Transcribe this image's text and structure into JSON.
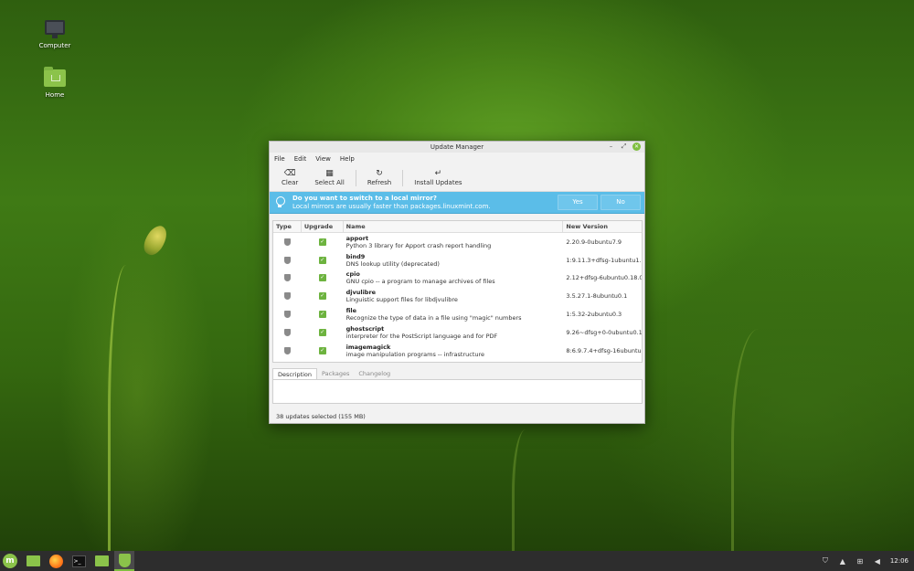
{
  "desktop": {
    "icons": [
      {
        "label": "Computer"
      },
      {
        "label": "Home"
      }
    ]
  },
  "window": {
    "title": "Update Manager",
    "menu": [
      "File",
      "Edit",
      "View",
      "Help"
    ],
    "toolbar": {
      "clear": "Clear",
      "select_all": "Select All",
      "refresh": "Refresh",
      "install": "Install Updates"
    },
    "infobar": {
      "title": "Do you want to switch to a local mirror?",
      "message": "Local mirrors are usually faster than packages.linuxmint.com.",
      "yes": "Yes",
      "no": "No"
    },
    "columns": {
      "type": "Type",
      "upgrade": "Upgrade",
      "name": "Name",
      "version": "New Version"
    },
    "packages": [
      {
        "name": "apport",
        "desc": "Python 3 library for Apport crash report handling",
        "version": "2.20.9-0ubuntu7.9",
        "checked": true
      },
      {
        "name": "bind9",
        "desc": "DNS lookup utility (deprecated)",
        "version": "1:9.11.3+dfsg-1ubuntu1.1",
        "checked": true
      },
      {
        "name": "cpio",
        "desc": "GNU cpio -- a program to manage archives of files",
        "version": "2.12+dfsg-6ubuntu0.18.04",
        "checked": true
      },
      {
        "name": "djvulibre",
        "desc": "Linguistic support files for libdjvulibre",
        "version": "3.5.27.1-8ubuntu0.1",
        "checked": true
      },
      {
        "name": "file",
        "desc": "Recognize the type of data in a file using \"magic\" numbers",
        "version": "1:5.32-2ubuntu0.3",
        "checked": true
      },
      {
        "name": "ghostscript",
        "desc": "interpreter for the PostScript language and for PDF",
        "version": "9.26~dfsg+0-0ubuntu0.18",
        "checked": true
      },
      {
        "name": "imagemagick",
        "desc": "image manipulation programs -- infrastructure",
        "version": "8:6.9.7.4+dfsg-16ubuntu6.",
        "checked": true
      }
    ],
    "tabs": [
      "Description",
      "Packages",
      "Changelog"
    ],
    "active_tab": "Description",
    "status": "38 updates selected (155 MB)"
  },
  "taskbar": {
    "clock": "12:06"
  }
}
